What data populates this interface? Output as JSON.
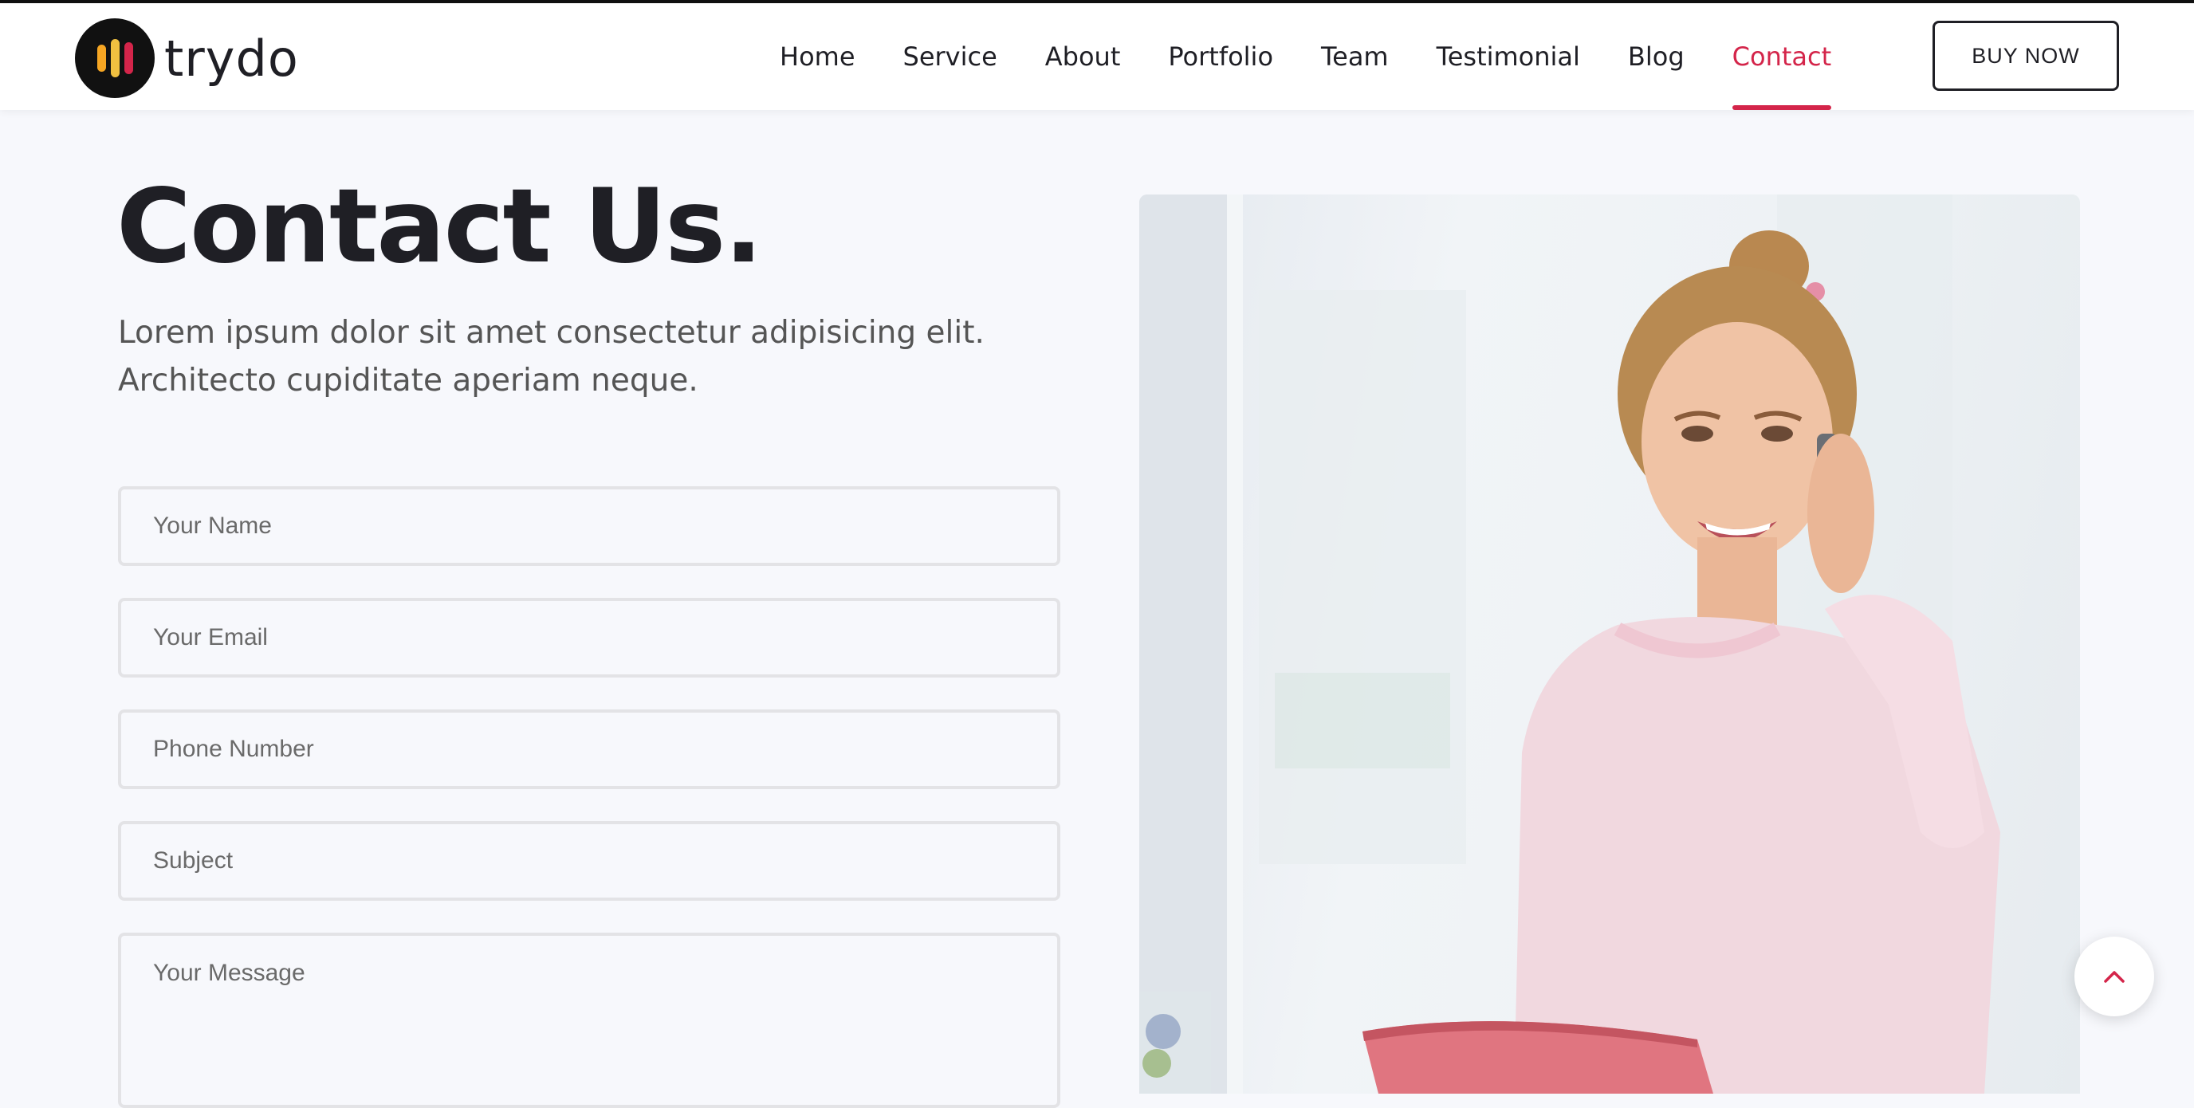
{
  "brand": {
    "name": "trydo",
    "colors": {
      "accent": "#d4254a",
      "logo_bars": [
        "#f6a623",
        "#f0c040",
        "#d4254a"
      ]
    }
  },
  "nav": {
    "items": [
      {
        "label": "Home"
      },
      {
        "label": "Service"
      },
      {
        "label": "About"
      },
      {
        "label": "Portfolio"
      },
      {
        "label": "Team"
      },
      {
        "label": "Testimonial"
      },
      {
        "label": "Blog"
      },
      {
        "label": "Contact",
        "active": true
      }
    ],
    "cta_label": "BUY NOW"
  },
  "contact": {
    "title": "Contact Us.",
    "description": "Lorem ipsum dolor sit amet consectetur adipisicing elit. Architecto cupiditate aperiam neque.",
    "form": {
      "name_placeholder": "Your Name",
      "email_placeholder": "Your Email",
      "phone_placeholder": "Phone Number",
      "subject_placeholder": "Subject",
      "message_placeholder": "Your Message"
    }
  },
  "icons": {
    "scroll_top": "chevron-up-icon",
    "logo": "logo-bars-icon"
  }
}
